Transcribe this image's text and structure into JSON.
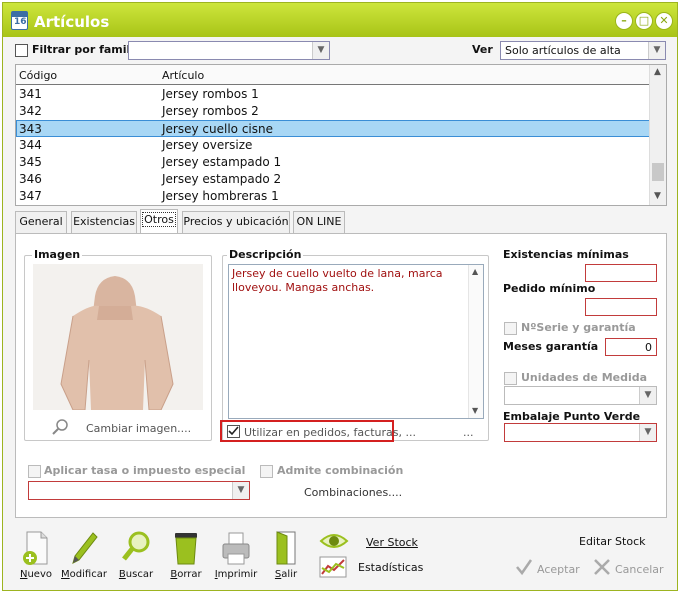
{
  "window": {
    "title": "Artículos",
    "app_icon_text": "16"
  },
  "filter": {
    "family_label": "Filtrar por familia",
    "family_value": "",
    "ver_label": "Ver",
    "ver_value": "Solo artículos de alta"
  },
  "list": {
    "headers": [
      "Código",
      "Artículo"
    ],
    "rows": [
      {
        "code": "341",
        "name": "Jersey rombos 1"
      },
      {
        "code": "342",
        "name": "Jersey rombos 2"
      },
      {
        "code": "343",
        "name": "Jersey cuello cisne"
      },
      {
        "code": "344",
        "name": "Jersey oversize"
      },
      {
        "code": "345",
        "name": "Jersey estampado 1"
      },
      {
        "code": "346",
        "name": "Jersey estampado 2"
      },
      {
        "code": "347",
        "name": "Jersey hombreras 1"
      }
    ],
    "selected_code": "343"
  },
  "tabs": [
    "General",
    "Existencias",
    "Otros",
    "Precios y ubicación",
    "ON LINE"
  ],
  "active_tab": "Otros",
  "otros": {
    "image_label": "Imagen",
    "change_image": "Cambiar imagen....",
    "description_label": "Descripción",
    "description_text": "Jersey de cuello vuelto de lana, marca lloveyou. Mangas anchas.",
    "use_in_label": "Utilizar en pedidos, facturas, ...",
    "use_in_checked": true,
    "more_dots": "...",
    "stock_min_label": "Existencias mínimas",
    "stock_min_value": "",
    "order_min_label": "Pedido mínimo",
    "order_min_value": "",
    "serie_label": "NºSerie y garantía",
    "warranty_label": "Meses garantía",
    "warranty_value": "0",
    "units_label": "Unidades de Medida",
    "units_value": "",
    "packaging_label": "Embalaje Punto Verde",
    "packaging_value": "",
    "tax_label": "Aplicar tasa o impuesto especial",
    "tax_value": "",
    "combination_label": "Admite combinación",
    "combinations_link": "Combinaciones...."
  },
  "toolbar": {
    "nuevo": "Nuevo",
    "modificar": "Modificar",
    "buscar": "Buscar",
    "borrar": "Borrar",
    "imprimir": "Imprimir",
    "salir": "Salir",
    "ver_stock": "Ver Stock",
    "estadisticas": "Estadísticas",
    "editar_stock": "Editar Stock",
    "aceptar": "Aceptar",
    "cancelar": "Cancelar"
  },
  "colors": {
    "titlebar": "#b5cf22",
    "selection": "#a8d7f5",
    "required_border": "#c23b3b",
    "description_text": "#a01010"
  }
}
